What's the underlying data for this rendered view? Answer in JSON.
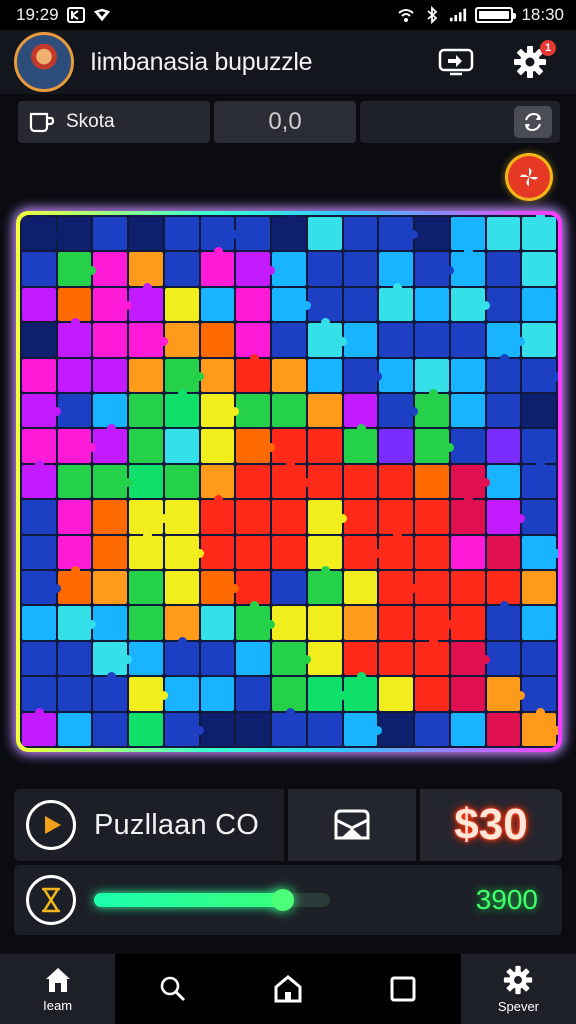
{
  "status_bar": {
    "time_left": "19:29",
    "time_right": "18:30"
  },
  "header": {
    "title": "Iimbanasia bupuzzle",
    "notification_count": "1"
  },
  "toolbar": {
    "mode_label": "Skota",
    "score": "0,0"
  },
  "board": {
    "rows": 15,
    "cols": 15,
    "colors": [
      "#0e1f6e",
      "#1d3fc4",
      "#18b4ff",
      "#35e0e8",
      "#26d14a",
      "#0fe06a",
      "#f2ee1e",
      "#ff9a1a",
      "#ff6a00",
      "#ff2a1a",
      "#e01050",
      "#ff1ad8",
      "#c31aff",
      "#7a2cff",
      "#1a2a9e",
      "#1a8c40"
    ],
    "cells": [
      [
        0,
        0,
        1,
        0,
        1,
        1,
        1,
        0,
        3,
        1,
        1,
        0,
        2,
        3,
        3
      ],
      [
        1,
        4,
        11,
        7,
        1,
        11,
        12,
        2,
        1,
        1,
        2,
        1,
        2,
        1,
        3
      ],
      [
        12,
        8,
        11,
        12,
        6,
        2,
        11,
        2,
        1,
        1,
        3,
        2,
        3,
        1,
        2
      ],
      [
        0,
        12,
        11,
        11,
        7,
        8,
        11,
        1,
        3,
        2,
        1,
        1,
        1,
        2,
        3
      ],
      [
        11,
        12,
        12,
        7,
        4,
        7,
        9,
        7,
        2,
        1,
        2,
        3,
        2,
        1,
        1
      ],
      [
        12,
        1,
        2,
        4,
        5,
        6,
        4,
        4,
        7,
        12,
        1,
        4,
        2,
        1,
        0
      ],
      [
        11,
        11,
        12,
        4,
        3,
        6,
        8,
        9,
        9,
        4,
        13,
        4,
        1,
        13,
        1
      ],
      [
        12,
        4,
        4,
        5,
        4,
        7,
        9,
        9,
        9,
        9,
        9,
        8,
        10,
        2,
        1
      ],
      [
        1,
        11,
        8,
        6,
        6,
        9,
        9,
        9,
        6,
        9,
        9,
        9,
        10,
        12,
        1
      ],
      [
        1,
        11,
        8,
        6,
        6,
        9,
        9,
        9,
        6,
        9,
        9,
        9,
        11,
        10,
        2
      ],
      [
        1,
        8,
        7,
        4,
        6,
        8,
        9,
        1,
        4,
        6,
        9,
        9,
        9,
        9,
        7
      ],
      [
        2,
        3,
        2,
        4,
        7,
        3,
        4,
        6,
        6,
        7,
        9,
        9,
        9,
        1,
        2
      ],
      [
        1,
        1,
        3,
        2,
        1,
        1,
        2,
        4,
        6,
        9,
        9,
        9,
        10,
        1,
        1
      ],
      [
        1,
        1,
        1,
        6,
        2,
        2,
        1,
        4,
        5,
        5,
        6,
        9,
        10,
        7,
        1
      ],
      [
        12,
        2,
        1,
        5,
        1,
        0,
        0,
        1,
        1,
        2,
        0,
        1,
        2,
        10,
        7
      ]
    ]
  },
  "puzzle_panel": {
    "name": "Puzllaan CO",
    "price": "$30"
  },
  "progress_panel": {
    "progress": 0.8,
    "total": "3900"
  },
  "nav": {
    "items": [
      {
        "label": "Ieam",
        "icon": "home-icon"
      },
      {
        "label": "",
        "icon": "search-icon"
      },
      {
        "label": "",
        "icon": "house-outline-icon"
      },
      {
        "label": "",
        "icon": "square-icon"
      },
      {
        "label": "Spever",
        "icon": "settings-icon"
      }
    ]
  }
}
